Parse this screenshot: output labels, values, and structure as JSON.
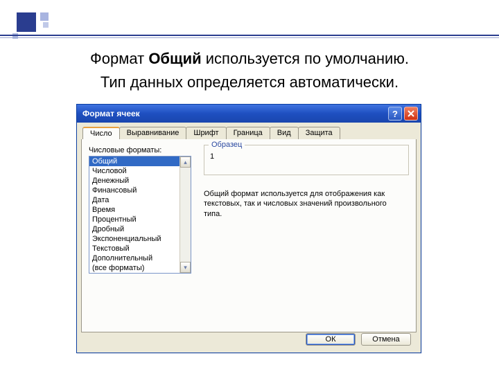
{
  "caption": {
    "pre": "Формат ",
    "bold": "Общий",
    "post": " используется по умолчанию.",
    "line2": "Тип данных определяется автоматически."
  },
  "dialog": {
    "title": "Формат ячеек",
    "tabs": [
      "Число",
      "Выравнивание",
      "Шрифт",
      "Граница",
      "Вид",
      "Защита"
    ],
    "active_tab": 0,
    "formats_label": "Числовые форматы:",
    "formats": [
      "Общий",
      "Числовой",
      "Денежный",
      "Финансовый",
      "Дата",
      "Время",
      "Процентный",
      "Дробный",
      "Экспоненциальный",
      "Текстовый",
      "Дополнительный",
      "(все форматы)"
    ],
    "selected_format": 0,
    "sample_label": "Образец",
    "sample_value": "1",
    "description": "Общий формат используется для отображения как текстовых, так и числовых значений произвольного типа.",
    "ok": "ОК",
    "cancel": "Отмена"
  }
}
